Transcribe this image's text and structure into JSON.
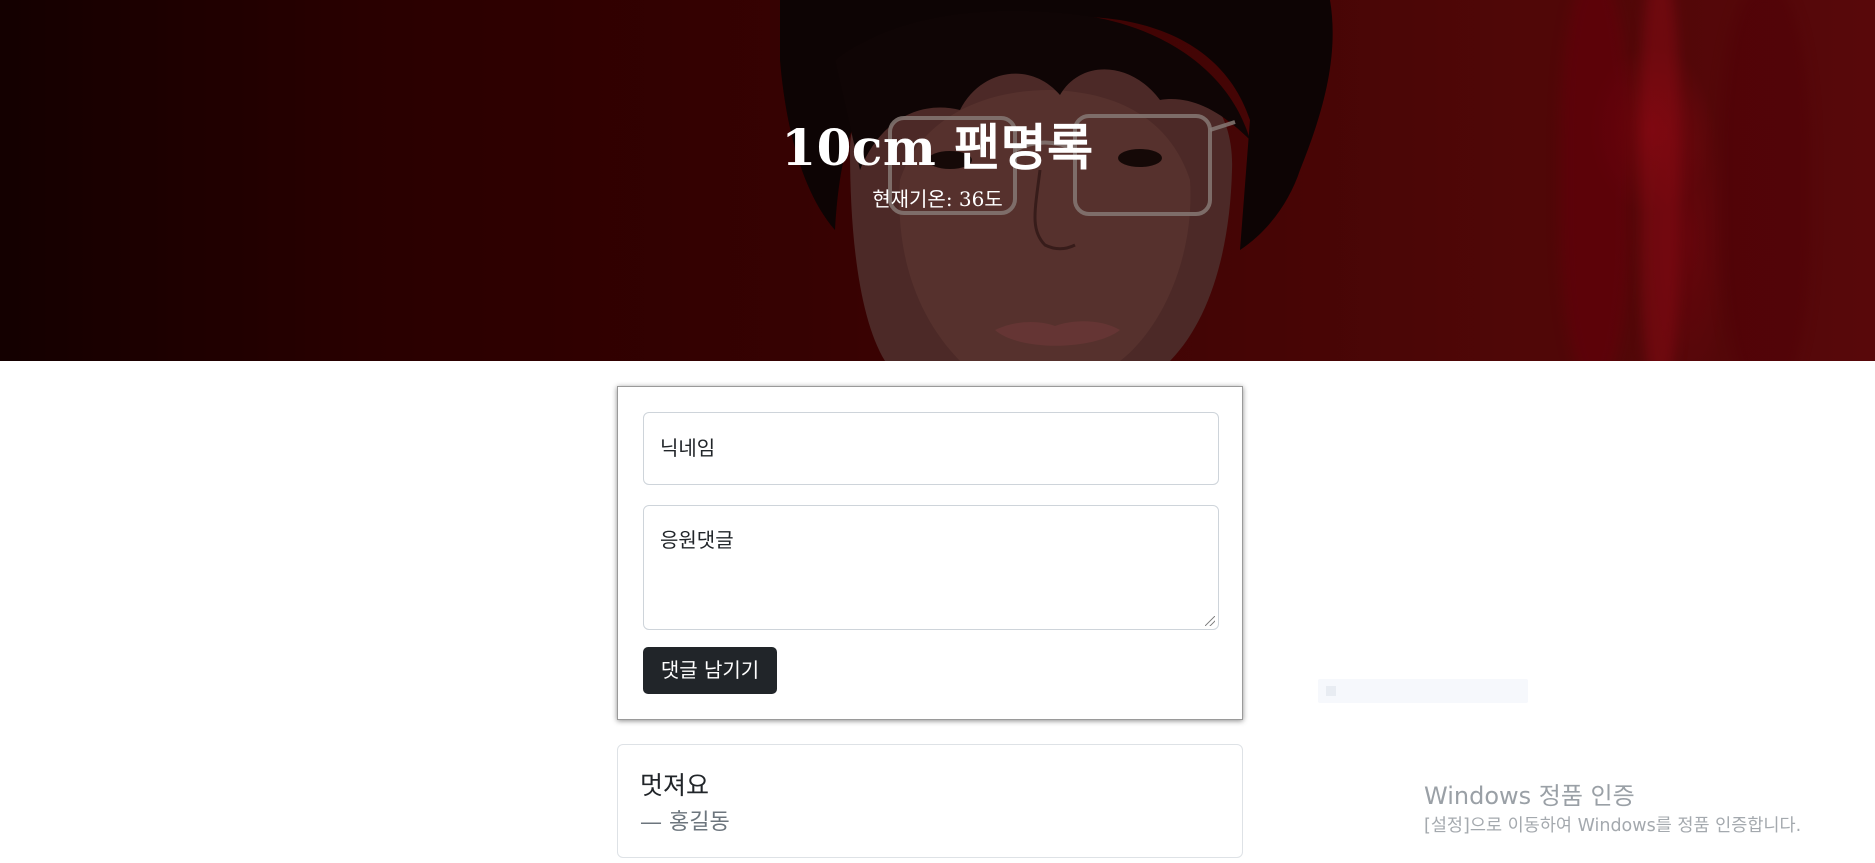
{
  "hero": {
    "title": "10cm 팬명록",
    "weather": "현재기온: 36도"
  },
  "form": {
    "nickname_placeholder": "닉네임",
    "comment_placeholder": "응원댓글",
    "submit_label": "댓글 남기기"
  },
  "comments": [
    {
      "text": "멋져요",
      "author": "— 홍길동"
    }
  ],
  "system": {
    "activation_title": "Windows 정품 인증",
    "activation_desc": "[설정]으로 이동하여 Windows를 정품 인증합니다."
  },
  "colors": {
    "hero_bg": "#4e0303",
    "button_bg": "#212529",
    "muted_text": "#6c757d"
  }
}
